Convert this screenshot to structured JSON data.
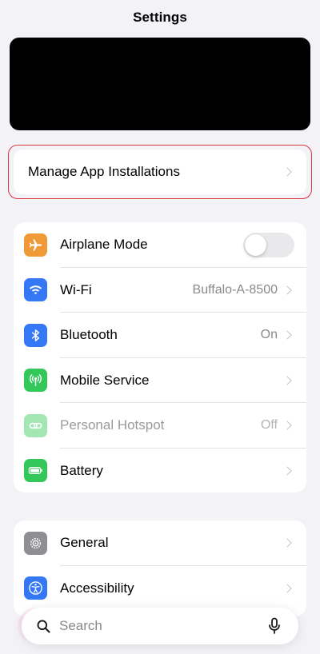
{
  "header": {
    "title": "Settings"
  },
  "manage": {
    "label": "Manage App Installations"
  },
  "connectivity": {
    "airplane": {
      "label": "Airplane Mode",
      "enabled": false
    },
    "wifi": {
      "label": "Wi-Fi",
      "value": "Buffalo-A-8500"
    },
    "bluetooth": {
      "label": "Bluetooth",
      "value": "On"
    },
    "mobile": {
      "label": "Mobile Service"
    },
    "hotspot": {
      "label": "Personal Hotspot",
      "value": "Off"
    },
    "battery": {
      "label": "Battery"
    }
  },
  "system": {
    "general": {
      "label": "General"
    },
    "accessibility": {
      "label": "Accessibility"
    }
  },
  "search": {
    "placeholder": "Search"
  },
  "colors": {
    "orange": "#f09a37",
    "blue": "#3478f6",
    "green": "#34c759",
    "gray": "#8e8e93",
    "highlight": "#d9363e"
  }
}
